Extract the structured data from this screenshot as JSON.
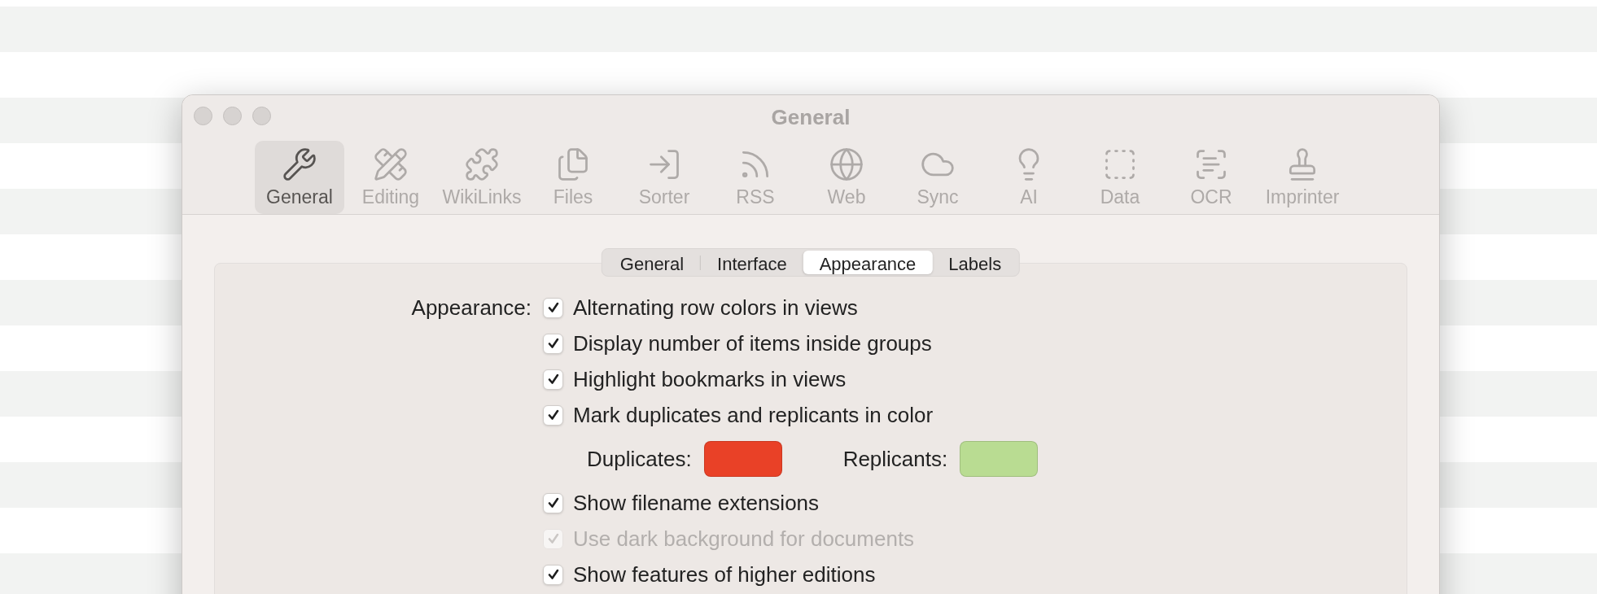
{
  "window": {
    "title": "General"
  },
  "toolbar": [
    {
      "label": "General",
      "selected": true
    },
    {
      "label": "Editing",
      "selected": false
    },
    {
      "label": "WikiLinks",
      "selected": false
    },
    {
      "label": "Files",
      "selected": false
    },
    {
      "label": "Sorter",
      "selected": false
    },
    {
      "label": "RSS",
      "selected": false
    },
    {
      "label": "Web",
      "selected": false
    },
    {
      "label": "Sync",
      "selected": false
    },
    {
      "label": "AI",
      "selected": false
    },
    {
      "label": "Data",
      "selected": false
    },
    {
      "label": "OCR",
      "selected": false
    },
    {
      "label": "Imprinter",
      "selected": false
    }
  ],
  "tabs": [
    {
      "label": "General",
      "selected": false
    },
    {
      "label": "Interface",
      "selected": false
    },
    {
      "label": "Appearance",
      "selected": true
    },
    {
      "label": "Labels",
      "selected": false
    }
  ],
  "section_label": "Appearance:",
  "options": [
    {
      "kind": "checkbox",
      "label": "Alternating row colors in views",
      "checked": true,
      "disabled": false
    },
    {
      "kind": "checkbox",
      "label": "Display number of items inside groups",
      "checked": true,
      "disabled": false
    },
    {
      "kind": "checkbox",
      "label": "Highlight bookmarks in views",
      "checked": true,
      "disabled": false
    },
    {
      "kind": "checkbox",
      "label": "Mark duplicates and replicants in color",
      "checked": true,
      "disabled": false
    },
    {
      "kind": "colors",
      "swatches": [
        {
          "label": "Duplicates:",
          "color": "#e94127"
        },
        {
          "label": "Replicants:",
          "color": "#b9dc92"
        }
      ]
    },
    {
      "kind": "checkbox",
      "label": "Show filename extensions",
      "checked": true,
      "disabled": false
    },
    {
      "kind": "checkbox",
      "label": "Use dark background for documents",
      "checked": true,
      "disabled": true
    },
    {
      "kind": "checkbox",
      "label": "Show features of higher editions",
      "checked": true,
      "disabled": false
    }
  ]
}
